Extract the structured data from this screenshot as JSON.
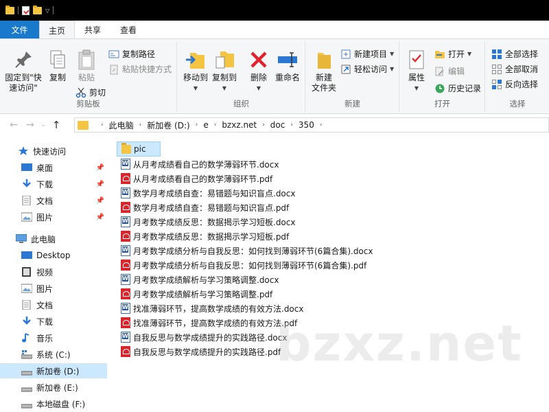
{
  "ribbon_tabs": [
    "文件",
    "主页",
    "共享",
    "查看"
  ],
  "clipboard": {
    "pin_label": "固定到\"快速访问\"",
    "copy_label": "复制",
    "paste_label": "粘贴",
    "copy_path_label": "复制路径",
    "paste_shortcut_label": "粘贴快捷方式",
    "cut_label": "剪切",
    "group_label": "剪贴板"
  },
  "organize": {
    "move_to_label": "移动到",
    "copy_to_label": "复制到",
    "delete_label": "删除",
    "rename_label": "重命名",
    "group_label": "组织"
  },
  "new": {
    "new_folder_label": "新建\n文件夹",
    "new_item_label": "新建项目",
    "easy_access_label": "轻松访问",
    "group_label": "新建"
  },
  "open": {
    "properties_label": "属性",
    "open_label": "打开",
    "edit_label": "编辑",
    "history_label": "历史记录",
    "group_label": "打开"
  },
  "select": {
    "select_all_label": "全部选择",
    "select_none_label": "全部取消",
    "invert_label": "反向选择",
    "group_label": "选择"
  },
  "breadcrumbs": [
    "此电脑",
    "新加卷 (D:)",
    "e",
    "bzxz.net",
    "doc",
    "350"
  ],
  "nav": {
    "quick_access": "快速访问",
    "quick_items": [
      "桌面",
      "下载",
      "文档",
      "图片"
    ],
    "this_pc": "此电脑",
    "pc_items": [
      "Desktop",
      "视频",
      "图片",
      "文档",
      "下载",
      "音乐",
      "系统 (C:)",
      "新加卷 (D:)",
      "新加卷 (E:)",
      "本地磁盘 (F:)"
    ]
  },
  "files": [
    {
      "name": "pic",
      "type": "folder"
    },
    {
      "name": "从月考成绩看自己的数学薄弱环节.docx",
      "type": "docx"
    },
    {
      "name": "从月考成绩看自己的数学薄弱环节.pdf",
      "type": "pdf"
    },
    {
      "name": "数学月考成绩自查：易错题与知识盲点.docx",
      "type": "docx"
    },
    {
      "name": "数学月考成绩自查：易错题与知识盲点.pdf",
      "type": "pdf"
    },
    {
      "name": "月考数学成绩反思：数据揭示学习短板.docx",
      "type": "docx"
    },
    {
      "name": "月考数学成绩反思：数据揭示学习短板.pdf",
      "type": "pdf"
    },
    {
      "name": "月考数学成绩分析与自我反思：如何找到薄弱环节(6篇合集).docx",
      "type": "docx"
    },
    {
      "name": "月考数学成绩分析与自我反思：如何找到薄弱环节(6篇合集).pdf",
      "type": "pdf"
    },
    {
      "name": "月考数学成绩解析与学习策略调整.docx",
      "type": "docx"
    },
    {
      "name": "月考数学成绩解析与学习策略调整.pdf",
      "type": "pdf"
    },
    {
      "name": "找准薄弱环节，提高数学成绩的有效方法.docx",
      "type": "docx"
    },
    {
      "name": "找准薄弱环节，提高数学成绩的有效方法.pdf",
      "type": "pdf"
    },
    {
      "name": "自我反思与数学成绩提升的实践路径.docx",
      "type": "docx"
    },
    {
      "name": "自我反思与数学成绩提升的实践路径.pdf",
      "type": "pdf"
    }
  ],
  "watermark": "bzxz.net"
}
